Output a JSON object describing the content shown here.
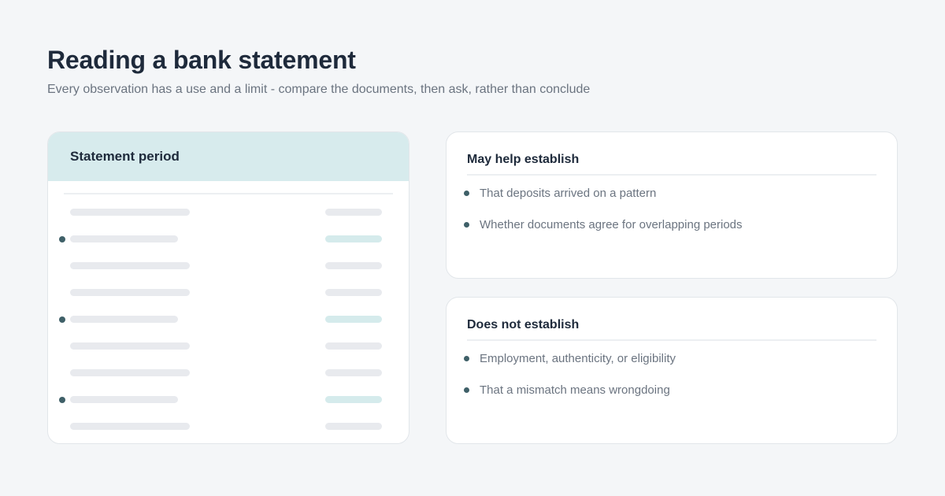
{
  "header": {
    "title": "Reading a bank statement",
    "subtitle": "Every observation has a use and a limit - compare the documents, then ask, rather than conclude"
  },
  "statement": {
    "title": "Statement period",
    "rows": [
      {
        "flagged": false,
        "desc_long": true
      },
      {
        "flagged": true,
        "desc_long": false
      },
      {
        "flagged": false,
        "desc_long": true
      },
      {
        "flagged": false,
        "desc_long": true
      },
      {
        "flagged": true,
        "desc_long": false
      },
      {
        "flagged": false,
        "desc_long": true
      },
      {
        "flagged": false,
        "desc_long": true
      },
      {
        "flagged": true,
        "desc_long": false
      },
      {
        "flagged": false,
        "desc_long": true
      }
    ]
  },
  "may_help": {
    "title": "May help establish",
    "items": [
      "That deposits arrived on a pattern",
      "Whether documents agree for overlapping periods"
    ]
  },
  "does_not": {
    "title": "Does not establish",
    "items": [
      "Employment, authenticity, or eligibility",
      "That a mismatch means wrongdoing"
    ]
  },
  "colors": {
    "background": "#f4f6f8",
    "header_fill": "#d7ebed",
    "accent_dot": "#3f6068",
    "flag_bar": "#d5ebec",
    "neutral_bar": "#e8eaee"
  }
}
